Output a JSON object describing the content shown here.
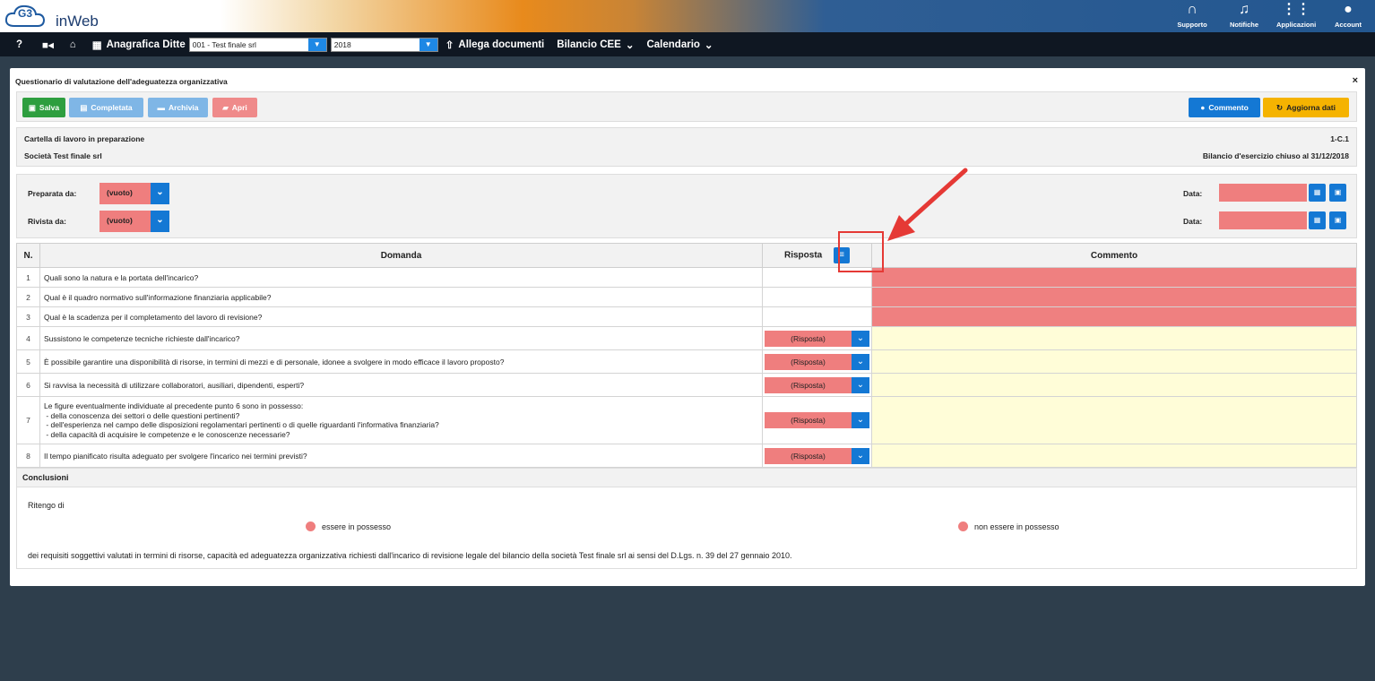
{
  "app": {
    "logo_text": "inWeb",
    "logo_mark": "G3"
  },
  "top_icons": [
    {
      "name": "headset-icon",
      "label": "Supporto",
      "glyph": "∩"
    },
    {
      "name": "bell-icon",
      "label": "Notifiche",
      "glyph": "♫"
    },
    {
      "name": "apps-icon",
      "label": "Applicazioni",
      "glyph": "⋮⋮"
    },
    {
      "name": "account-icon",
      "label": "Account",
      "glyph": "●"
    }
  ],
  "nav": {
    "help": "?",
    "anagrafica_label": "Anagrafica Ditte",
    "company_select_value": "001 - Test finale srl",
    "year_select_value": "2018",
    "allega_label": "Allega documenti",
    "bilancio_label": "Bilancio CEE",
    "calendario_label": "Calendario"
  },
  "panel": {
    "title": "Questionario di valutazione dell'adeguatezza organizzativa",
    "close": "×"
  },
  "toolbar": {
    "salva": "Salva",
    "completata": "Completata",
    "archivia": "Archivia",
    "apri": "Apri",
    "commento": "Commento",
    "aggiorna": "Aggiorna dati"
  },
  "info": {
    "status": "Cartella di lavoro in preparazione",
    "code": "1-C.1",
    "company": "Società Test finale srl",
    "bilancio": "Bilancio d'esercizio chiuso al 31/12/2018"
  },
  "signoff": {
    "preparata_label": "Preparata da:",
    "rivista_label": "Rivista da:",
    "empty_value": "(vuoto)",
    "data_label": "Data:"
  },
  "table": {
    "headers": {
      "n": "N.",
      "domanda": "Domanda",
      "risposta": "Risposta",
      "commento": "Commento"
    },
    "risposta_placeholder": "(Risposta)",
    "rows": [
      {
        "n": "1",
        "domanda": "Quali sono la natura e la portata dell'incarico?"
      },
      {
        "n": "2",
        "domanda": "Qual è il quadro normativo sull'informazione finanziaria applicabile?"
      },
      {
        "n": "3",
        "domanda": "Qual è la scadenza per il completamento del lavoro di revisione?"
      },
      {
        "n": "4",
        "domanda": "Sussistono le competenze tecniche richieste dall'incarico?"
      },
      {
        "n": "5",
        "domanda": "È possibile garantire una disponibilità di risorse, in termini di mezzi e di personale, idonee a svolgere in modo efficace il lavoro proposto?"
      },
      {
        "n": "6",
        "domanda": "Si ravvisa la necessità di utilizzare collaboratori, ausiliari, dipendenti, esperti?"
      },
      {
        "n": "7",
        "domanda_lines": [
          "Le figure eventualmente individuate al precedente punto 6 sono in possesso:",
          " - della conoscenza dei settori o delle questioni pertinenti?",
          " - dell'esperienza nel campo delle disposizioni regolamentari pertinenti o di quelle riguardanti l'informativa finanziaria?",
          " - della capacità di acquisire le competenze e le conoscenze necessarie?"
        ]
      },
      {
        "n": "8",
        "domanda": "Il tempo pianificato risulta adeguato per svolgere l'incarico nei termini previsti?"
      }
    ]
  },
  "conclusioni": {
    "title": "Conclusioni",
    "intro": "Ritengo di",
    "option1": "essere in possesso",
    "option2": "non essere in possesso",
    "text": "dei requisiti soggettivi valutati in termini di risorse, capacità ed adeguatezza organizzativa richiesti dall'incarico di revisione legale del bilancio della società Test finale srl ai sensi del D.Lgs. n. 39 del 27 gennaio 2010."
  },
  "colors": {
    "accent": "#1478d4",
    "required": "#ef7e7e",
    "comment_bg": "#fffdd8",
    "annotation": "#e53935"
  }
}
